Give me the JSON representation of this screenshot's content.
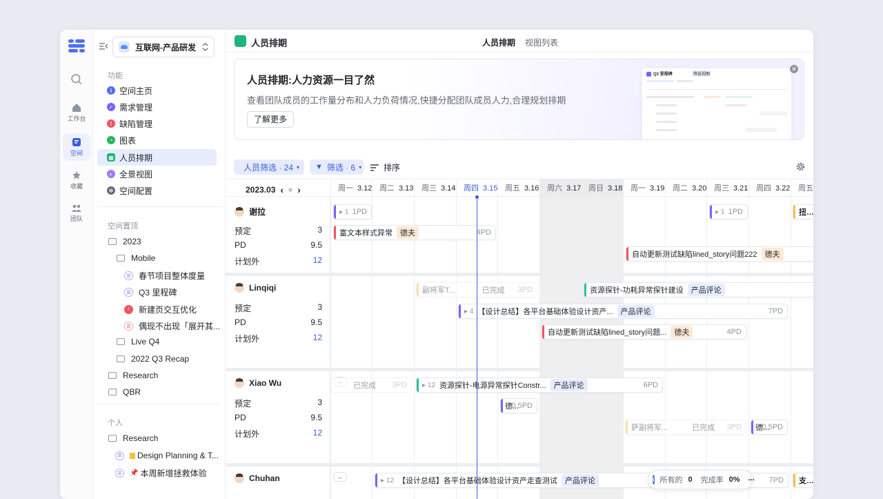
{
  "rail": {
    "items": [
      {
        "label": "",
        "icon": "search-icon"
      },
      {
        "label": "工作台",
        "icon": "home-icon"
      },
      {
        "label": "空间",
        "icon": "space-icon"
      },
      {
        "label": "收藏",
        "icon": "star-icon"
      },
      {
        "label": "团队",
        "icon": "team-icon"
      }
    ]
  },
  "sidebar": {
    "workspace": "互联网-产品研发",
    "section_func": "功能",
    "nav": [
      "空间主页",
      "需求管理",
      "缺陷管理",
      "图表",
      "人员排期",
      "全景视图",
      "空间配置"
    ],
    "section_pinned": "空间置顶",
    "tree": [
      "2023",
      "Mobile",
      "春节项目整体度量",
      "Q3 里程碑",
      "新建页交互优化",
      "偶现不出现「展开其...",
      "Live Q4",
      "2022 Q3 Recap",
      "Research",
      "QBR"
    ],
    "section_personal": "个人",
    "personal": [
      "Research",
      "Design Planning & T...",
      "本周新增拯救体验"
    ]
  },
  "header": {
    "title": "人员排期",
    "tabs": [
      "人员排期",
      "视图列表"
    ]
  },
  "banner": {
    "title": "人员排期:人力资源一目了然",
    "desc": "查看团队成员的工作量分布和人力负荷情况,快捷分配团队成员人力,合理规划排期",
    "button": "了解更多",
    "preview_title": "Q3 里程碑",
    "preview_filter": "筛选视图"
  },
  "toolbar": {
    "people_filter": "人员筛选 · 24",
    "filter": "筛选 · 6",
    "sort": "排序"
  },
  "calendar": {
    "month": "2023.03",
    "days": [
      {
        "w": "周一",
        "d": "3.12"
      },
      {
        "w": "周二",
        "d": "3.13"
      },
      {
        "w": "周三",
        "d": "3.14"
      },
      {
        "w": "周四",
        "d": "3.15"
      },
      {
        "w": "周五",
        "d": "3.16"
      },
      {
        "w": "周六",
        "d": "3.17"
      },
      {
        "w": "周日",
        "d": "3.18"
      },
      {
        "w": "周一",
        "d": "3.19"
      },
      {
        "w": "周二",
        "d": "3.20"
      },
      {
        "w": "周三",
        "d": "3.21"
      },
      {
        "w": "周四",
        "d": "3.22"
      },
      {
        "w": "周五",
        "d": ""
      }
    ]
  },
  "stats_labels": [
    "预定",
    "PD",
    "计划外"
  ],
  "people": [
    {
      "name": "谢拉",
      "stats": [
        "3",
        "9.5",
        "12"
      ]
    },
    {
      "name": "Linqiqi",
      "stats": [
        "3",
        "9.5",
        "12"
      ]
    },
    {
      "name": "Xiao Wu",
      "stats": [
        "3",
        "9.5",
        "12"
      ]
    },
    {
      "name": "Chuhan"
    }
  ],
  "tasks": {
    "t1": {
      "cnt": "1",
      "pd": "1PD"
    },
    "t2": {
      "name": "富文本样式异常",
      "tag": "德夫",
      "pd": "4PD"
    },
    "t3": {
      "cnt": "1",
      "pd": "1PD"
    },
    "t4": {
      "name": "扭曲的"
    },
    "t5": {
      "name": "自动更新测试缺陷lined_story问题222",
      "tag": "德夫"
    },
    "t6": {
      "name": "副将军T...",
      "tag": "已完成",
      "pd": "3PD"
    },
    "t7": {
      "name": "资源探针-功耗异常探针建设",
      "tag": "产品评论"
    },
    "t8": {
      "cnt": "4",
      "name": "【设计总结】各平台基础体验设计资产...",
      "tag": "产品评论",
      "pd": "7PD"
    },
    "t9": {
      "name": "自动更新测试缺陷lined_story问题...",
      "tag": "德夫",
      "pd": "4PD"
    },
    "t10": {
      "name": "已完成",
      "pd": "3PD"
    },
    "t11": {
      "cnt": "12",
      "name": "资源探针-电源异常探针Constr...",
      "tag": "产品评论",
      "pd": "6PD"
    },
    "t12": {
      "name": "德...",
      "pd": "0.5PD"
    },
    "t13": {
      "name": "萨副将军...",
      "tag": "已完成",
      "pd": "3PD"
    },
    "t14": {
      "name": "德...",
      "pd": "0.5PD"
    },
    "t15": {
      "cnt": "12",
      "name": "【设计总结】各平台基础体验设计资产走查测试",
      "tag": "产品评论",
      "pd": "7PD"
    },
    "t16": {
      "name": "支持普"
    }
  },
  "status": {
    "label1": "所有的",
    "v1": "0",
    "label2": "完成率",
    "v2": "0%",
    "more": "..."
  }
}
